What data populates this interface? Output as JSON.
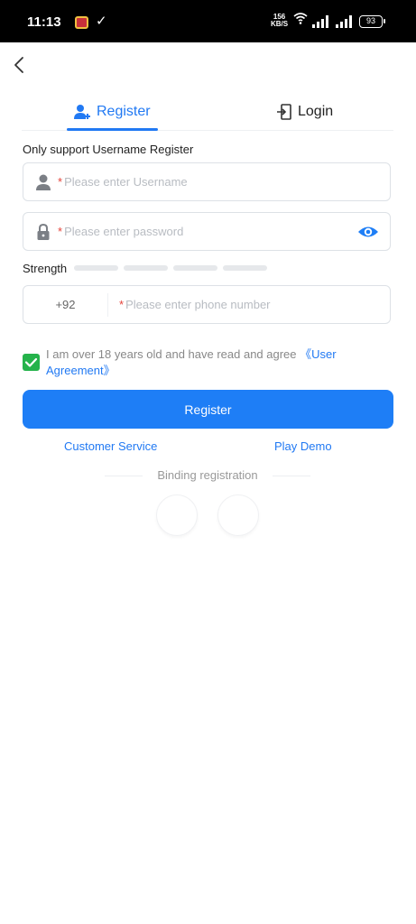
{
  "status_bar": {
    "time": "11:13",
    "network_speed_top": "156",
    "network_speed_unit": "KB/S",
    "battery": "93"
  },
  "tabs": {
    "register": "Register",
    "login": "Login"
  },
  "form": {
    "hint": "Only support Username Register",
    "required_mark": "*",
    "username_placeholder": "Please enter Username",
    "password_placeholder": "Please enter password",
    "strength_label": "Strength",
    "country_code": "+92",
    "phone_placeholder": "Please enter phone number"
  },
  "agreement": {
    "text": "I am over 18 years old and have read and agree ",
    "link": "《User Agreement》",
    "checked": true
  },
  "register_button": "Register",
  "links": {
    "customer_service": "Customer Service",
    "play_demo": "Play Demo"
  },
  "binding_label": "Binding registration",
  "colors": {
    "accent": "#2179f3",
    "button": "#1e7ef6",
    "checkbox": "#25b34b",
    "required": "#e5443b"
  }
}
